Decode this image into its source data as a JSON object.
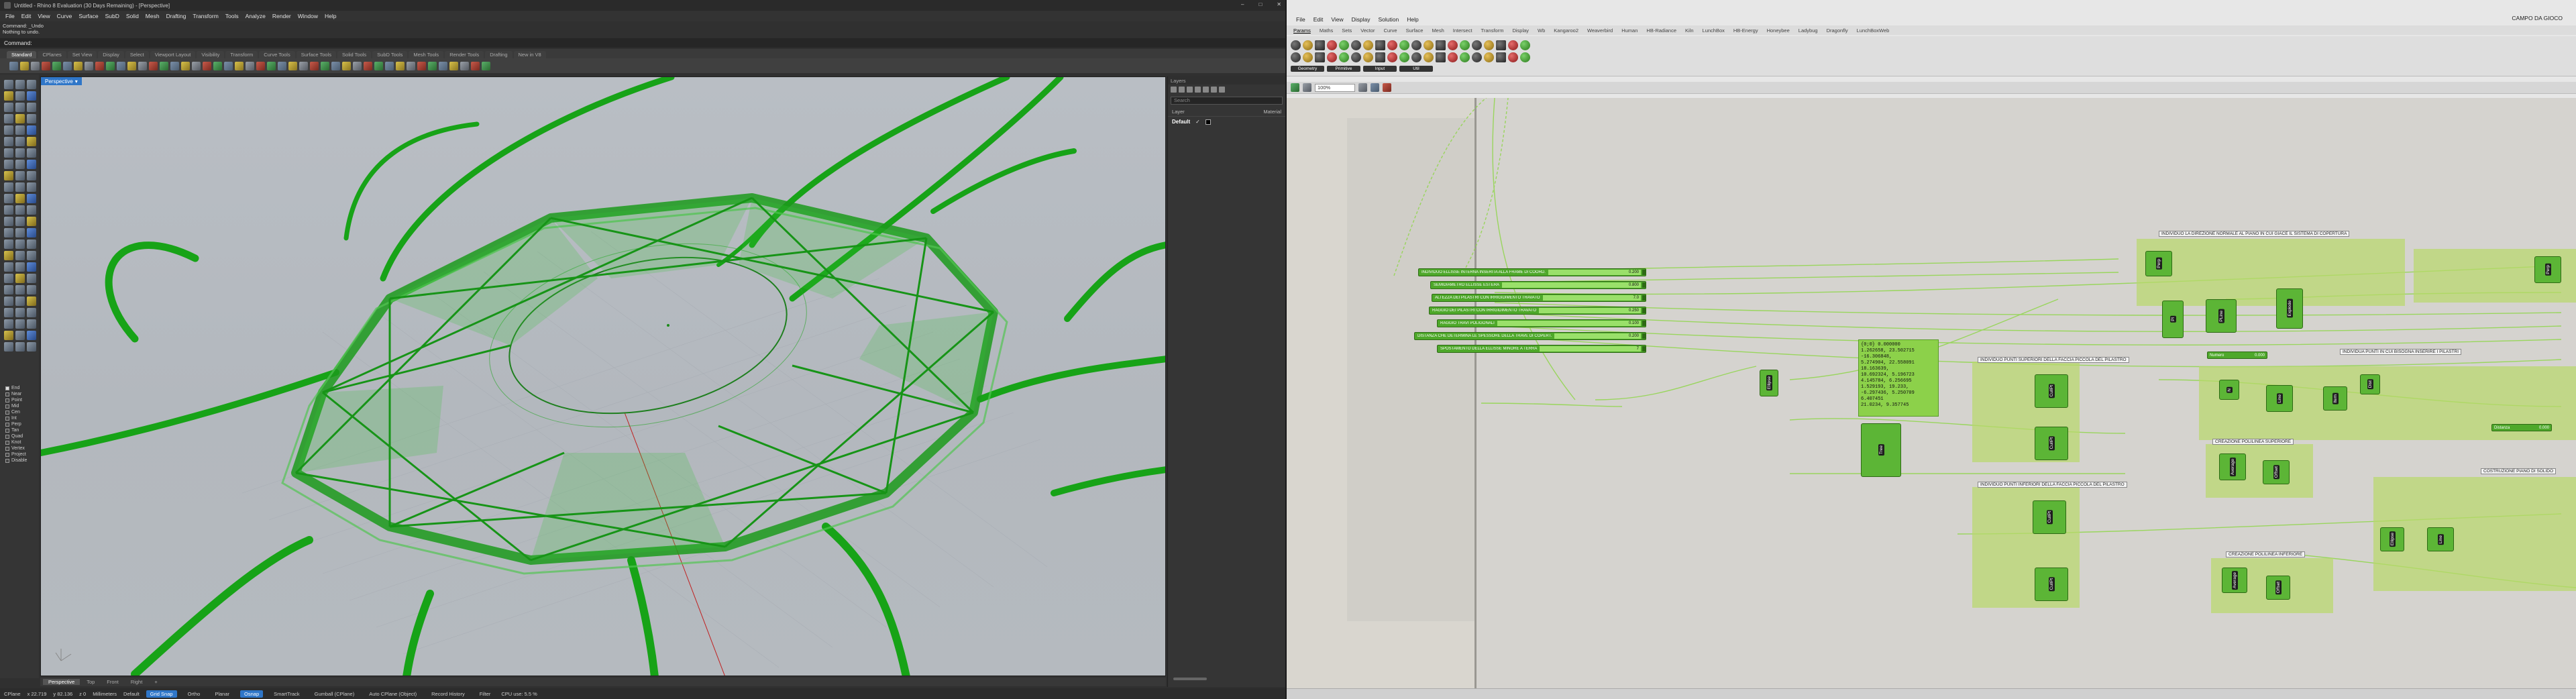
{
  "rhino": {
    "title": "Untitled - Rhino 8 Evaluation (30 Days Remaining) - [Perspective]",
    "menu": [
      "File",
      "Edit",
      "View",
      "Curve",
      "Surface",
      "SubD",
      "Solid",
      "Mesh",
      "Drafting",
      "Transform",
      "Tools",
      "Analyze",
      "Render",
      "Window",
      "Help"
    ],
    "command_history": [
      "Command: _Undo",
      "Nothing to undo."
    ],
    "command_prompt": "Command:",
    "toolbar_tabs": [
      "Standard",
      "CPlanes",
      "Set View",
      "Display",
      "Select",
      "Viewport Layout",
      "Visibility",
      "Transform",
      "Curve Tools",
      "Surface Tools",
      "Solid Tools",
      "SubD Tools",
      "Mesh Tools",
      "Render Tools",
      "Drafting",
      "New in V8"
    ],
    "viewport_label": "Perspective",
    "viewport_tabs": [
      "Perspective",
      "Top",
      "Front",
      "Right"
    ],
    "panel": {
      "tabs": "Layers",
      "search_placeholder": "Search",
      "col_layer": "Layer",
      "col_material": "Material",
      "default_layer": "Default",
      "check": "✓"
    },
    "osnaps": [
      {
        "label": "End",
        "on": true
      },
      {
        "label": "Near",
        "on": false
      },
      {
        "label": "Point",
        "on": false
      },
      {
        "label": "Mid",
        "on": false
      },
      {
        "label": "Cen",
        "on": false
      },
      {
        "label": "Int",
        "on": false
      },
      {
        "label": "Perp",
        "on": false
      },
      {
        "label": "Tan",
        "on": false
      },
      {
        "label": "Quad",
        "on": false
      },
      {
        "label": "Knot",
        "on": false
      },
      {
        "label": "Vertex",
        "on": false
      },
      {
        "label": "Project",
        "on": false
      },
      {
        "label": "Disable",
        "on": false
      }
    ],
    "status": {
      "cplane": "CPlane",
      "x": "x 22.719",
      "y": "y 82.136",
      "z": "z 0",
      "units": "Millimeters",
      "layer": "Default",
      "grid_snap": "Grid Snap",
      "ortho": "Ortho",
      "planar": "Planar",
      "osnap": "Osnap",
      "smarttrack": "SmartTrack",
      "gumball": "Gumball (CPlane)",
      "autocplane": "Auto CPlane (Object)",
      "record_history": "Record History",
      "filter": "Filter",
      "cpu": "CPU use: 5.5 %"
    }
  },
  "gh": {
    "menu": [
      "File",
      "Edit",
      "View",
      "Display",
      "Solution",
      "Help"
    ],
    "doc_name": "CAMPO DA GIOCO",
    "tabs": [
      "Params",
      "Maths",
      "Sets",
      "Vector",
      "Curve",
      "Surface",
      "Mesh",
      "Intersect",
      "Transform",
      "Display",
      "Wb",
      "Kangaroo2",
      "Weaverbird",
      "Human",
      "HB-Radiance",
      "Kiln",
      "LunchBox",
      "HB-Energy",
      "Honeybee",
      "Ladybug",
      "Dragonfly",
      "LunchBoxWeb"
    ],
    "categories": [
      "Geometry",
      "Primitive",
      "Input",
      "Util"
    ],
    "zoom": "100%",
    "sliders": [
      {
        "label": "INDIVIDUO ELLISSE INTERNA INSERITA ALLA FRAME DI COORD.",
        "value": "0.200"
      },
      {
        "label": "SEMIDIAMETRO ELLISSE ESTERA",
        "value": "0.800"
      },
      {
        "label": "ALTEZZA DEI PILASTRI CON IRRIGIDIMENTO TRAVATO",
        "value": "7.0"
      },
      {
        "label": "RAGGIO DEI PILASTRI CON IRRIGIDIMENTO TRAVATO",
        "value": "0.250"
      },
      {
        "label": "RAGGIO TRAVI POLIGONALI",
        "value": "0.100"
      },
      {
        "label": "DISTANZA CHE DETERMINA LE SPESSORE DELLA TRAVE DI COPERT.",
        "value": "0.200"
      },
      {
        "label": "SPOSTAMENTO DELLA ELLISSE MINORE A TERRA",
        "value": "7"
      }
    ],
    "panel_values": [
      "{0;0} 0.000000",
      "1.262658, 23.502715",
      "-16.306848,",
      "5.274904, 22.558091",
      "18.163639,",
      "10.692324, 5.196723",
      "4.145784, 6.256695",
      "1.529193, 19.233,",
      "-6.297436, 5.250709",
      "6.407451",
      "21.0234, 9.357745"
    ],
    "groups": [
      {
        "label": "INDIVIDUO LA DIREZIONE NORMALE AL PIANO IN CUI GIACE IL SISTEMA DI COPERTURA"
      },
      {
        "label": "INDIVIDUO PUNTI SUPERIORI DELLA FACCIA PICCOLA DEL PILASTRO"
      },
      {
        "label": "INDIVIDUA PUNTI IN CUI BISOGNA INSERIRE I PILASTRI"
      },
      {
        "label": "CREAZIONE POLILINEA SUPERIORE"
      },
      {
        "label": "COSTRUZIONE PIANO DI SOLIDO"
      },
      {
        "label": "INDIVIDUO PUNTI INFERIORI DELLA FACCIA PICCOLA DEL PILASTRO"
      },
      {
        "label": "CREAZIONE POLILINEA INFERIORE"
      }
    ],
    "node_labels": {
      "average": "Average",
      "cull": "CullPt",
      "ellipse": "Ellipse",
      "perp": "Perp",
      "pl": "Pl",
      "pline": "PLine",
      "explode": "Explode",
      "offset": "Offset",
      "item": "Item",
      "gene_pool": "Gene",
      "line": "Line",
      "ellipse_comp": "Ellipse",
      "n": "N",
      "dist": "Dist",
      "tree": "Tree",
      "slider_small1": "Numero",
      "slider_small2": "Distanza",
      "slider_small1_val": "0.000",
      "slider_small2_val": "0.000"
    }
  }
}
